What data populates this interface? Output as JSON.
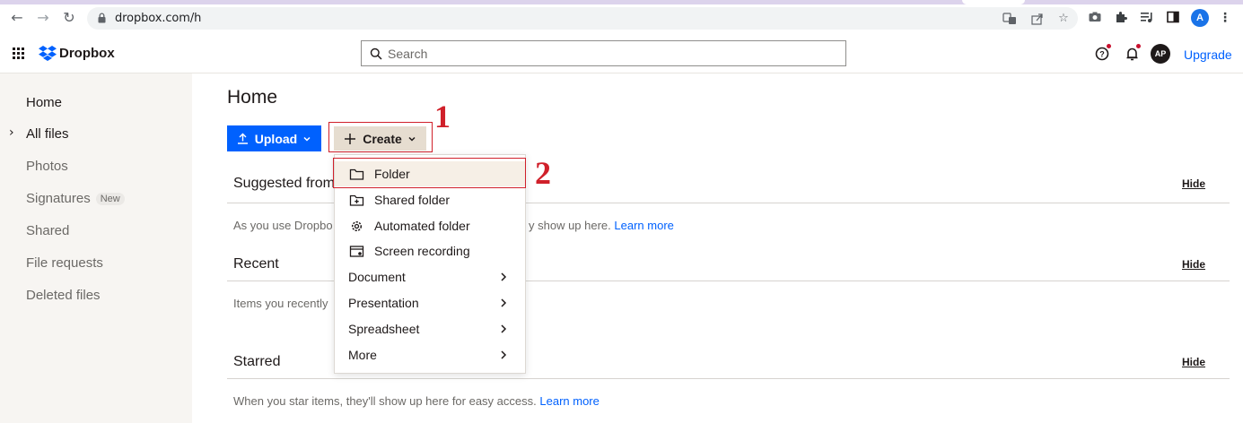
{
  "browser": {
    "url": "dropbox.com/h",
    "profile_initial": "A",
    "icons": [
      "back-arrow-icon",
      "forward-arrow-icon",
      "reload-icon",
      "lock-icon",
      "translate-icon",
      "share-icon",
      "star-icon",
      "camera-icon",
      "extensions-puzzle-icon",
      "media-control-icon",
      "side-panel-icon",
      "more-vert-icon"
    ]
  },
  "header": {
    "logo_text": "Dropbox",
    "search_placeholder": "Search",
    "avatar_initials": "AP",
    "upgrade_label": "Upgrade"
  },
  "sidebar": {
    "items": [
      {
        "label": "Home"
      },
      {
        "label": "All files"
      },
      {
        "label": "Photos"
      },
      {
        "label": "Signatures",
        "badge": "New"
      },
      {
        "label": "Shared"
      },
      {
        "label": "File requests"
      },
      {
        "label": "Deleted files"
      }
    ]
  },
  "main": {
    "title": "Home",
    "upload_label": "Upload",
    "create_label": "Create",
    "sections": {
      "suggested": {
        "title": "Suggested from",
        "hide": "Hide",
        "text_start": "As you use Dropbo",
        "text_end": "y show up here.",
        "link": "Learn more"
      },
      "recent": {
        "title": "Recent",
        "hide": "Hide",
        "text": "Items you recently"
      },
      "starred": {
        "title": "Starred",
        "hide": "Hide",
        "text": "When you star items, they'll show up here for easy access.",
        "link": "Learn more"
      }
    }
  },
  "dropdown": {
    "items": [
      {
        "label": "Folder",
        "icon": "folder-icon"
      },
      {
        "label": "Shared folder",
        "icon": "shared-folder-icon"
      },
      {
        "label": "Automated folder",
        "icon": "gear-icon"
      },
      {
        "label": "Screen recording",
        "icon": "screen-recording-icon"
      },
      {
        "label": "Document"
      },
      {
        "label": "Presentation"
      },
      {
        "label": "Spreadsheet"
      },
      {
        "label": "More"
      }
    ]
  },
  "annotations": [
    "1",
    "2"
  ],
  "colors": {
    "accent": "#0061fe",
    "annotation": "#d0202a",
    "create_bg": "#e6ddd0",
    "sidebar_bg": "#f7f5f2"
  }
}
